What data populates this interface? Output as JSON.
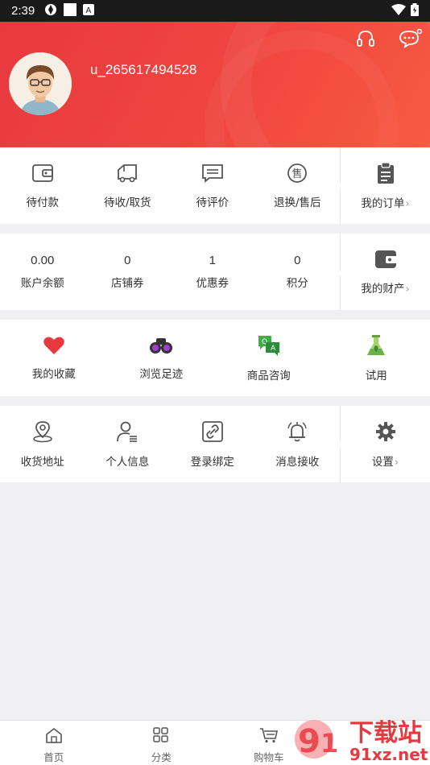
{
  "status_bar": {
    "time": "2:39"
  },
  "profile": {
    "username": "u_265617494528"
  },
  "header_icons": [
    "headset-icon",
    "message-icon"
  ],
  "orders": {
    "items": [
      {
        "label": "待付款",
        "icon": "wallet-icon"
      },
      {
        "label": "待收/取货",
        "icon": "truck-icon"
      },
      {
        "label": "待评价",
        "icon": "comment-icon"
      },
      {
        "label": "退换/售后",
        "icon": "after-sale-icon"
      }
    ],
    "my_orders": {
      "label": "我的订单",
      "icon": "clipboard-icon"
    }
  },
  "assets": {
    "items": [
      {
        "value": "0.00",
        "label": "账户余额"
      },
      {
        "value": "0",
        "label": "店铺券"
      },
      {
        "value": "1",
        "label": "优惠券"
      },
      {
        "value": "0",
        "label": "积分"
      }
    ],
    "my_assets": {
      "label": "我的财产",
      "icon": "purse-icon"
    }
  },
  "features": [
    {
      "label": "我的收藏",
      "icon": "heart-icon",
      "color": "#e8393f"
    },
    {
      "label": "浏览足迹",
      "icon": "binoculars-icon",
      "color": "#7b2fa0"
    },
    {
      "label": "商品咨询",
      "icon": "qa-icon",
      "color": "#3fae49"
    },
    {
      "label": "试用",
      "icon": "flask-icon",
      "color": "#8bc34a"
    }
  ],
  "services": {
    "items": [
      {
        "label": "收货地址",
        "icon": "location-icon"
      },
      {
        "label": "个人信息",
        "icon": "user-info-icon"
      },
      {
        "label": "登录绑定",
        "icon": "link-icon"
      },
      {
        "label": "消息接收",
        "icon": "bell-icon"
      }
    ],
    "settings": {
      "label": "设置",
      "icon": "gear-icon"
    }
  },
  "tabbar": [
    {
      "label": "首页",
      "icon": "home-icon"
    },
    {
      "label": "分类",
      "icon": "category-icon"
    },
    {
      "label": "购物车",
      "icon": "cart-icon"
    },
    {
      "label": "",
      "icon": ""
    }
  ],
  "watermark": {
    "text_top": "下载站",
    "text_bottom": "91xz.net"
  },
  "colors": {
    "brand_red": "#e8393f",
    "icon_gray": "#555555"
  }
}
